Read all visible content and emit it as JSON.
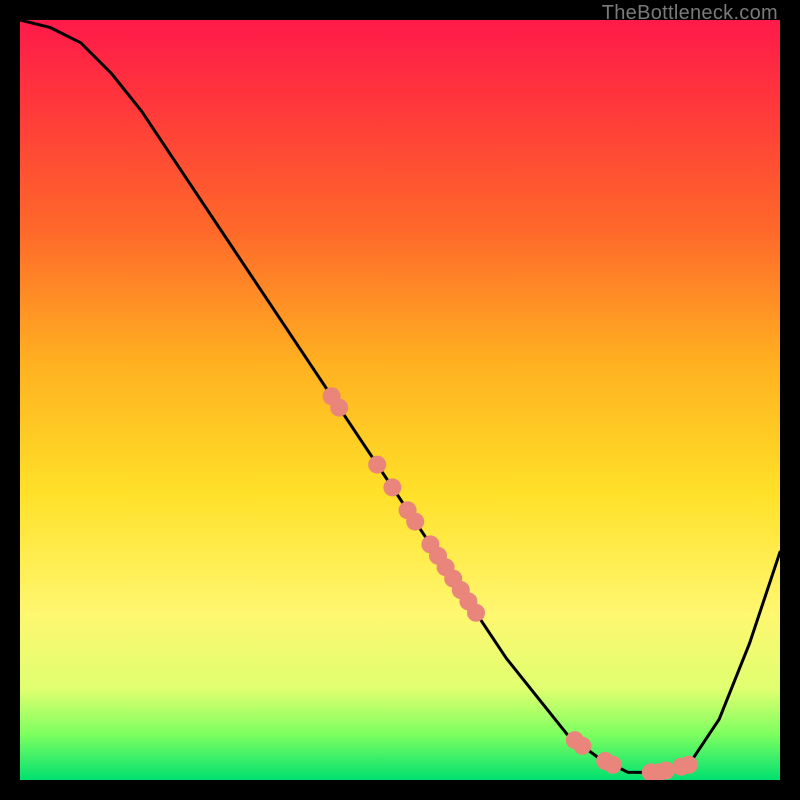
{
  "watermark": "TheBottleneck.com",
  "chart_data": {
    "type": "line",
    "title": "",
    "xlabel": "",
    "ylabel": "",
    "xlim": [
      0,
      100
    ],
    "ylim": [
      0,
      100
    ],
    "grid": false,
    "series": [
      {
        "name": "curve",
        "x": [
          0,
          4,
          8,
          12,
          16,
          20,
          24,
          28,
          32,
          36,
          40,
          44,
          48,
          52,
          56,
          60,
          64,
          68,
          72,
          76,
          80,
          84,
          88,
          92,
          96,
          100
        ],
        "y": [
          100,
          99,
          97,
          93,
          88,
          82,
          76,
          70,
          64,
          58,
          52,
          46,
          40,
          34,
          28,
          22,
          16,
          11,
          6,
          3,
          1,
          1,
          2,
          8,
          18,
          30
        ]
      }
    ],
    "points_on_curve_x": [
      41,
      42,
      47,
      49,
      51,
      52,
      54,
      55,
      56,
      57,
      58,
      59,
      60,
      73,
      74,
      77,
      78,
      83,
      84,
      85,
      87,
      88
    ]
  }
}
